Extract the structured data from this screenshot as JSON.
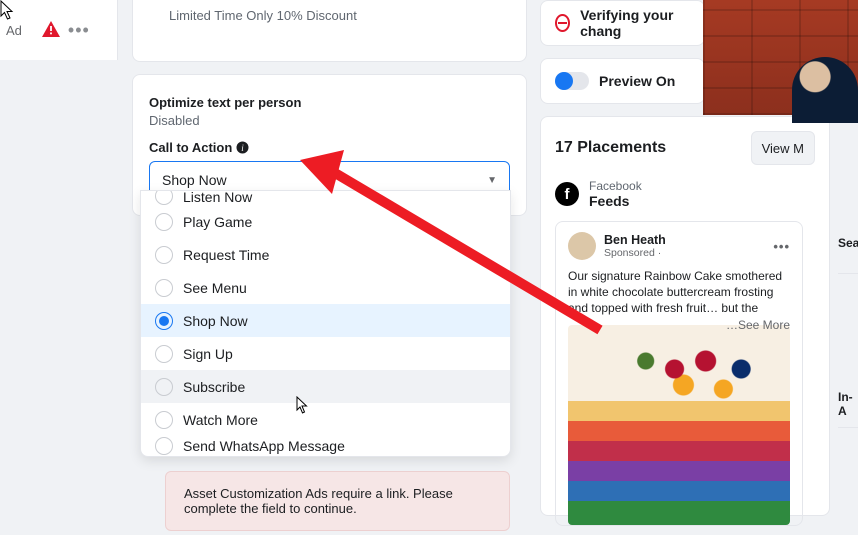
{
  "nav": {
    "item": "Ad"
  },
  "offer": "Limited Time Only 10% Discount",
  "optimize": {
    "label": "Optimize text per person",
    "status": "Disabled"
  },
  "cta": {
    "label": "Call to Action",
    "selected": "Shop Now",
    "options": [
      "Listen Now",
      "Play Game",
      "Request Time",
      "See Menu",
      "Shop Now",
      "Sign Up",
      "Subscribe",
      "Watch More",
      "Send WhatsApp Message"
    ]
  },
  "error": "Asset Customization Ads require a link. Please complete the field to continue.",
  "verify": "Verifying your chang",
  "preview": "Preview On",
  "placements": {
    "title": "17 Placements",
    "view": "View M"
  },
  "fb": {
    "brand": "Facebook",
    "surface": "Feeds"
  },
  "ad": {
    "name": "Ben Heath",
    "sponsored": "Sponsored ·",
    "body": "Our signature Rainbow Cake smothered in white chocolate buttercream frosting and topped with fresh fruit… but the",
    "seemore": "…See More"
  },
  "side": {
    "search": "Sea",
    "inapp": "In-A"
  }
}
